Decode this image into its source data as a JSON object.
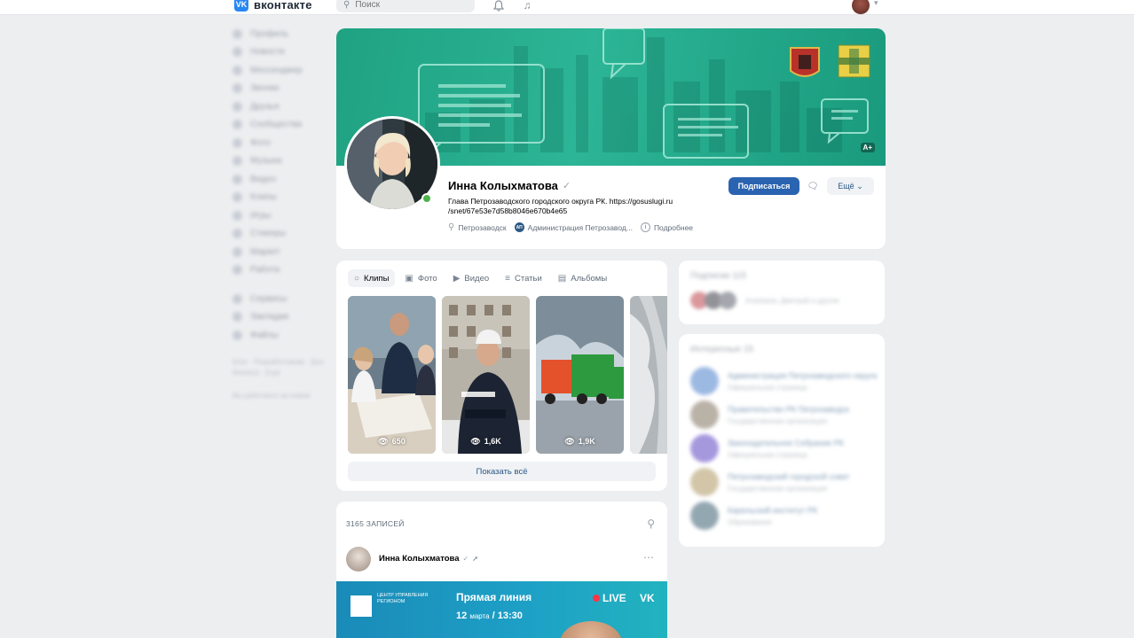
{
  "topbar": {
    "logo_badge": "VK",
    "logo_text": "вконтакте",
    "search_placeholder": "Поиск",
    "bell_icon": "bell-icon",
    "music_icon": "music-icon"
  },
  "sidebar": {
    "items": [
      "Профиль",
      "Новости",
      "Мессенджер",
      "Звонки",
      "Друзья",
      "Сообщества",
      "Фото",
      "Музыка",
      "Видео",
      "Клипы",
      "Игры",
      "Стикеры",
      "Маркет",
      "Работа",
      "Сервисы",
      "Закладки",
      "Файлы"
    ],
    "footer": "Блог · Разработчикам · Для бизнеса · Ещё",
    "footer2": "Вы работаете на новом"
  },
  "profile": {
    "name": "Инна Колыхматова",
    "status_line1": "Глава Петрозаводского городского округа РК. https://gosuslugi.ru",
    "status_line2": "/snet/67e53e7d58b8046e670b4e65",
    "location": "Петрозаводск",
    "org": "Администрация Петрозавод...",
    "details": "Подробнее",
    "subscribe": "Подписаться",
    "more": "Ещё",
    "cover_badge": "А+"
  },
  "media": {
    "tabs": [
      {
        "label": "Клипы",
        "icon": "clip-icon"
      },
      {
        "label": "Фото",
        "icon": "photo-icon"
      },
      {
        "label": "Видео",
        "icon": "video-icon"
      },
      {
        "label": "Статьи",
        "icon": "article-icon"
      },
      {
        "label": "Альбомы",
        "icon": "album-icon"
      }
    ],
    "clips": [
      {
        "views": "650"
      },
      {
        "views": "1,6K"
      },
      {
        "views": "1,9K"
      },
      {
        "views": ""
      }
    ],
    "show_all": "Показать всё"
  },
  "posts": {
    "count": "3165 ЗАПИСЕЙ",
    "author": "Инна Колыхматова",
    "banner_center": "ЦЕНТР УПРАВЛЕНИЯ РЕГИОНОМ",
    "banner_title": "Прямая линия",
    "banner_day": "12",
    "banner_month": "марта",
    "banner_time": "13:30",
    "banner_live": "LIVE",
    "banner_vk": "VK"
  },
  "right": {
    "subscriptions_title": "Подписки 115",
    "subscriptions_text": "Anastasia, Дмитрий и другие",
    "interesting_title": "Интересные 15",
    "pages": [
      {
        "name": "Администрация Петрозаводского округа",
        "desc": "Официальная страница"
      },
      {
        "name": "Правительство РК Петрозаводск",
        "desc": "Государственная организация"
      },
      {
        "name": "Законодательное Собрание РК",
        "desc": "Официальная страница"
      },
      {
        "name": "Петрозаводский городской совет",
        "desc": "Государственная организация"
      },
      {
        "name": "Карельский институт РК",
        "desc": "Образование"
      }
    ]
  }
}
